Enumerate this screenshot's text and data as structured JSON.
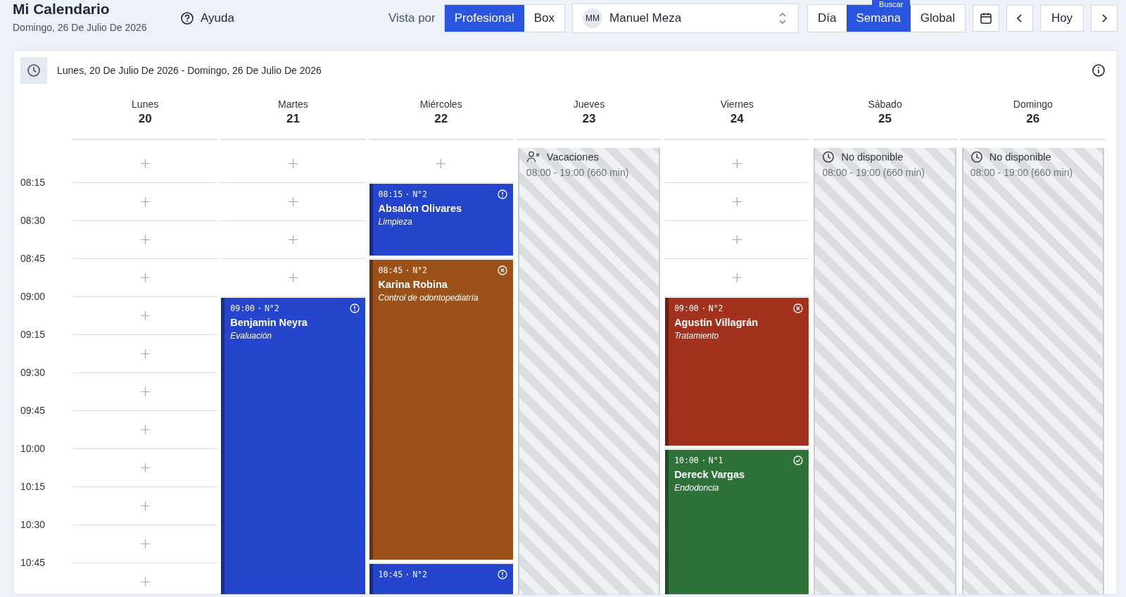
{
  "header": {
    "title": "Mi Calendario",
    "date": "Domingo, 26 De Julio De 2026",
    "help": "Ayuda",
    "view_label": "Vista por",
    "view_options": [
      {
        "label": "Profesional",
        "selected": true
      },
      {
        "label": "Box",
        "selected": false
      }
    ],
    "professional": {
      "initials": "MM",
      "name": "Manuel Meza"
    },
    "range_options": [
      {
        "label": "Día",
        "selected": false
      },
      {
        "label": "Semana",
        "selected": true
      },
      {
        "label": "Global",
        "selected": false
      }
    ],
    "tooltip": "Buscar",
    "today": "Hoy"
  },
  "week": {
    "range": "Lunes, 20 De Julio De 2026 - Domingo, 26 De Julio De 2026"
  },
  "times": [
    "08:15",
    "08:30",
    "08:45",
    "09:00",
    "09:15",
    "09:30",
    "09:45",
    "10:00",
    "10:15",
    "10:30",
    "10:45"
  ],
  "days": [
    {
      "name": "Lunes",
      "number": "20"
    },
    {
      "name": "Martes",
      "number": "21",
      "events": [
        {
          "time": "09:00",
          "number": "N°2",
          "patient": "Benjamin Neyra",
          "treatment": "Evaluación",
          "kind": "pending",
          "color": "#2545cc"
        }
      ]
    },
    {
      "name": "Miércoles",
      "number": "22",
      "events": [
        {
          "time": "08:15",
          "number": "N°2",
          "patient": "Absalón Olivares",
          "treatment": "Limpieza",
          "kind": "pending",
          "color": "#2545cc"
        },
        {
          "time": "08:45",
          "number": "N°2",
          "patient": "Karina Robina",
          "treatment": "Control de odontopediatría",
          "kind": "cancelled",
          "color": "#9c5118"
        },
        {
          "time": "10:45",
          "number": "N°2",
          "kind": "pending",
          "color": "#2545cc"
        }
      ]
    },
    {
      "name": "Jueves",
      "number": "23",
      "block": {
        "kind": "vacation",
        "title": "Vacaciones",
        "hours": "08:00 - 19:00 (660 min)"
      }
    },
    {
      "name": "Viernes",
      "number": "24",
      "events": [
        {
          "time": "09:00",
          "number": "N°2",
          "patient": "Agustín Villagrán",
          "treatment": "Tratamiento",
          "kind": "cancelled",
          "color": "#a2321e"
        },
        {
          "time": "10:00",
          "number": "N°1",
          "patient": "Dereck Vargas",
          "treatment": "Endodoncia",
          "kind": "confirmed",
          "color": "#2e723a"
        }
      ]
    },
    {
      "name": "Sábado",
      "number": "25",
      "block": {
        "kind": "unavailable",
        "title": "No disponible",
        "hours": "08:00 - 19:00 (660 min)"
      }
    },
    {
      "name": "Domingo",
      "number": "26",
      "block": {
        "kind": "unavailable",
        "title": "No disponible",
        "hours": "08:00 - 19:00 (660 min)"
      }
    }
  ]
}
